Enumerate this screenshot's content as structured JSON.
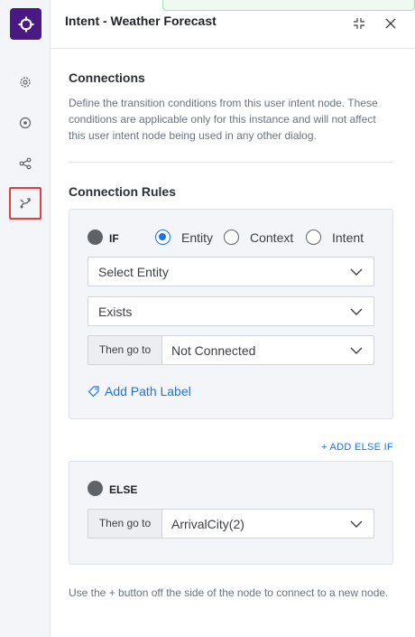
{
  "header": {
    "title": "Intent - Weather Forecast"
  },
  "connections": {
    "title": "Connections",
    "description": "Define the transition conditions from this user intent node. These conditions are applicable only for this instance and will not affect this user intent node being used in any other dialog."
  },
  "rules": {
    "title": "Connection Rules",
    "if_label": "IF",
    "radios": [
      {
        "label": "Entity",
        "checked": true
      },
      {
        "label": "Context",
        "checked": false
      },
      {
        "label": "Intent",
        "checked": false
      }
    ],
    "entity_select": "Select Entity",
    "condition_select": "Exists",
    "then_go_to": "Then go to",
    "if_target": "Not Connected",
    "add_path_label": "Add Path Label",
    "add_else_if": "+ ADD ELSE IF",
    "else_label": "ELSE",
    "else_target": "ArrivalCity(2)"
  },
  "footer": {
    "note": "Use the + button off the side of the node to connect to a new node."
  },
  "colors": {
    "brand": "#4a1a83",
    "accent": "#1a73e8",
    "active_outline": "#e53e3e"
  }
}
